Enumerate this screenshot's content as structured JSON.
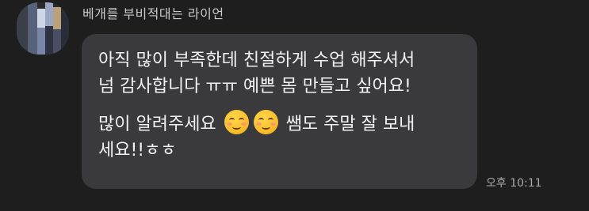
{
  "message": {
    "sender": "베개를 부비적대는 라이언",
    "lines_para1": "아직 많이 부족한데 친절하게 수업 해주셔서\n넘 감사합니다 ㅠㅠ 예쁜 몸 만들고 싶어요!",
    "para2_start": "많이 알려주세요",
    "para2_end": "쌤도 주말 잘 보내",
    "para2_line2": "세요!!ㅎㅎ",
    "emoji_icon": "smiling-face-with-smiling-eyes-icon",
    "emoji_count": 2,
    "time": "오후 10:11"
  },
  "colors": {
    "background": "#1e1e1e",
    "bubble": "#3a3a3c",
    "text": "#f2f2f2",
    "meta_text": "#a9a9a9"
  }
}
